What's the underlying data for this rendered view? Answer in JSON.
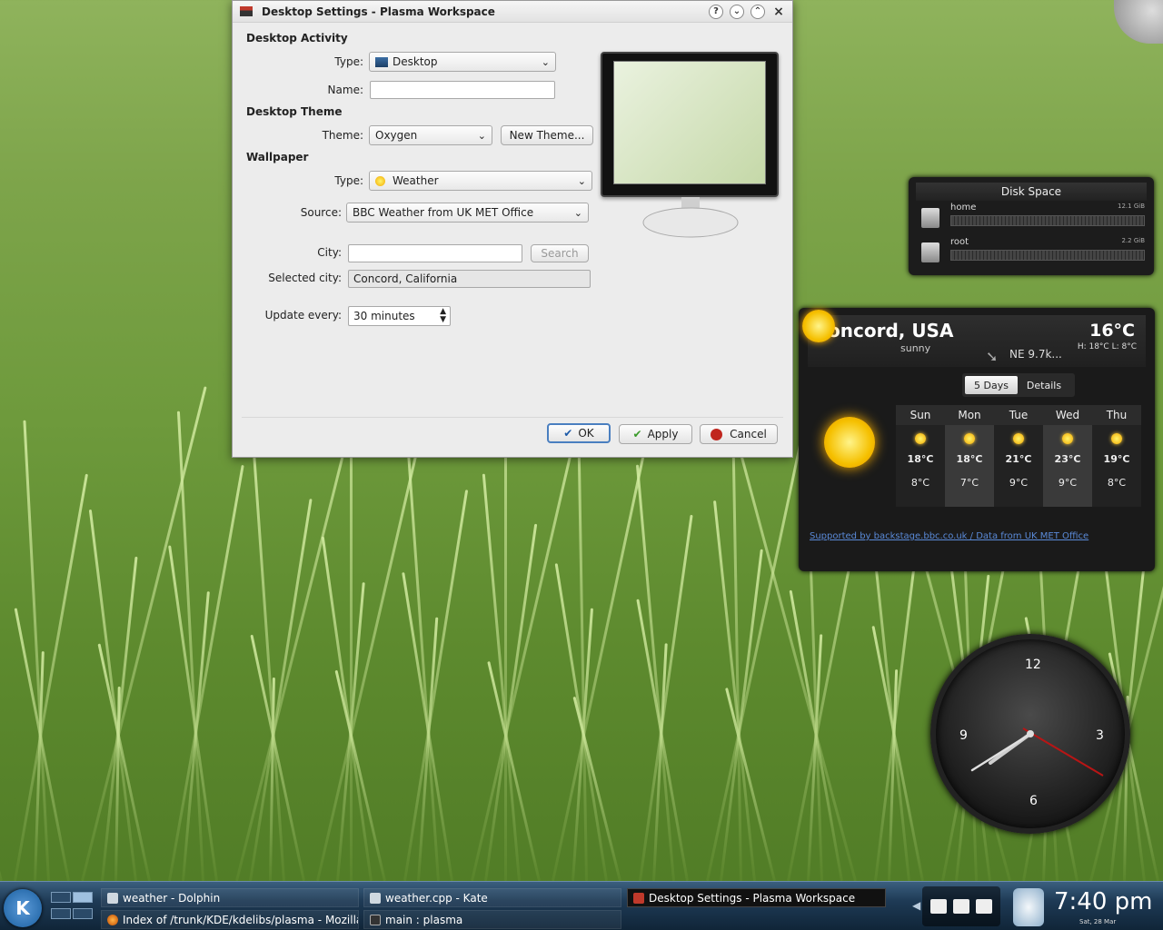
{
  "dialog": {
    "title": "Desktop Settings - Plasma Workspace",
    "title_buttons": [
      "?",
      "⌄",
      "⌃",
      "×"
    ],
    "sections": {
      "activity": "Desktop Activity",
      "theme": "Desktop Theme",
      "wallpaper": "Wallpaper"
    },
    "activity_type_label": "Type:",
    "activity_type_value": "Desktop",
    "name_label": "Name:",
    "name_value": "",
    "theme_label": "Theme:",
    "theme_value": "Oxygen",
    "new_theme_button": "New Theme...",
    "wallpaper_type_label": "Type:",
    "wallpaper_type_value": "Weather",
    "source_label": "Source:",
    "source_value": "BBC Weather from UK MET Office",
    "city_label": "City:",
    "city_value": "",
    "search_button": "Search",
    "selected_city_label": "Selected city:",
    "selected_city_value": "Concord, California",
    "update_label": "Update every:",
    "update_value": "30 minutes",
    "ok_button": "OK",
    "apply_button": "Apply",
    "cancel_button": "Cancel"
  },
  "disk_space": {
    "title": "Disk Space",
    "drives": [
      {
        "name": "home",
        "size": "12.1 GiB",
        "used_fraction": 0.95
      },
      {
        "name": "root",
        "size": "2.2 GiB",
        "used_fraction": 0.95
      }
    ]
  },
  "weather": {
    "location": "oncord, USA",
    "condition": "sunny",
    "temperature": "16°C",
    "high_low": "H: 18°C L: 8°C",
    "wind": "NE 9.7k...",
    "tabs": [
      "5 Days",
      "Details"
    ],
    "active_tab": "5 Days",
    "forecast": [
      {
        "day": "Sun",
        "high": "18°C",
        "low": "8°C"
      },
      {
        "day": "Mon",
        "high": "18°C",
        "low": "7°C"
      },
      {
        "day": "Tue",
        "high": "21°C",
        "low": "9°C"
      },
      {
        "day": "Wed",
        "high": "23°C",
        "low": "9°C"
      },
      {
        "day": "Thu",
        "high": "19°C",
        "low": "8°C"
      }
    ],
    "credit": "Supported by backstage.bbc.co.uk / Data from UK MET Office"
  },
  "clock": {
    "numerals": [
      "12",
      "3",
      "6",
      "9"
    ]
  },
  "taskbar": {
    "tasks": [
      {
        "label": "weather - Dolphin"
      },
      {
        "label": "weather.cpp - Kate"
      },
      {
        "label": "Desktop Settings - Plasma Workspace"
      },
      {
        "label": "Index of /trunk/KDE/kdelibs/plasma - Mozilla Fir..."
      },
      {
        "label": "main : plasma"
      }
    ],
    "time": "7:40 pm",
    "date": "Sat, 28 Mar"
  },
  "colors": {
    "accent": "#3b6ea5",
    "wallpaper": "#6e9a3c",
    "plasmoid_bg": "#1a1a1a"
  }
}
